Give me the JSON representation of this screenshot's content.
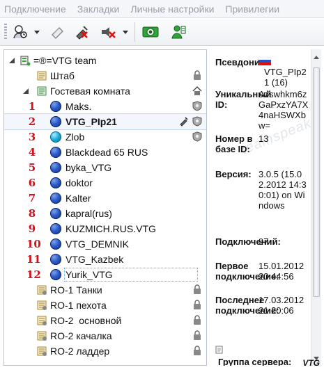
{
  "menu": [
    "Подключение",
    "Закладки",
    "Личные настройки",
    "Привилегии"
  ],
  "toolbar": {
    "buttons": [
      "connect-icon",
      "disconnect-icon",
      "mute-mic-icon",
      "mute-speakers-icon",
      "away-icon",
      "whisper-icon"
    ]
  },
  "tree": {
    "server": "=®=VTG team",
    "channels_top": [
      {
        "label": "Штаб",
        "locked": true
      },
      {
        "label": "Гостевая комната",
        "home": true
      }
    ],
    "users": [
      {
        "num": "1",
        "name": "Maks.",
        "cyan": false
      },
      {
        "num": "2",
        "name": "VTG_PIp21",
        "cyan": false,
        "bold": true,
        "selected": true
      },
      {
        "num": "3",
        "name": "Zlob",
        "cyan": true
      },
      {
        "num": "4",
        "name": "Blackdead 65 RUS",
        "cyan": false
      },
      {
        "num": "5",
        "name": "byka_VTG",
        "cyan": false
      },
      {
        "num": "6",
        "name": "doktor",
        "cyan": false
      },
      {
        "num": "7",
        "name": "Kalter",
        "cyan": false
      },
      {
        "num": "8",
        "name": "kapral(rus)",
        "cyan": false
      },
      {
        "num": "9",
        "name": "KUZMICH.RUS.VTG",
        "cyan": false
      },
      {
        "num": "10",
        "name": "VTG_DEMNIK",
        "cyan": false
      },
      {
        "num": "11",
        "name": "VTG_Kazbek",
        "cyan": false
      },
      {
        "num": "12",
        "name": "Yurik_VTG",
        "cyan": false,
        "outlined": true
      }
    ],
    "channels_bottom": [
      {
        "label": "RO-1 Танки"
      },
      {
        "label": "RO-1 пехота"
      },
      {
        "label": "RO-2  основной"
      },
      {
        "label": "RO-2 качалка"
      },
      {
        "label": "RO-2 ладдер"
      }
    ]
  },
  "info": {
    "nickname_key": "Псевдоним:",
    "nickname_val": "VTG_PIp21 (16)",
    "uid_key": "Уникальный ID:",
    "uid_val": "Azswhkm6zGaPxzYA7X4naHSWXbw=",
    "dbid_key": "Номер в базе ID:",
    "dbid_val": "13",
    "version_key": "Версия:",
    "version_val": "3.0.5 (15.02.2012 14:30:01) on Windows",
    "connections_key": "Подключений:",
    "connections_val": "97",
    "first_key": "Первое подключение:",
    "first_val": "15.01.2012 20:44:56",
    "last_key": "Последнее подключение:",
    "last_val": "17.03.2012 21:20:06",
    "group_label": "Группа сервера:",
    "watermark": "teamspeak3",
    "corner_mark": "VTG"
  },
  "colors": {
    "accent": "#2b57c9",
    "number_red": "#d4101b"
  }
}
